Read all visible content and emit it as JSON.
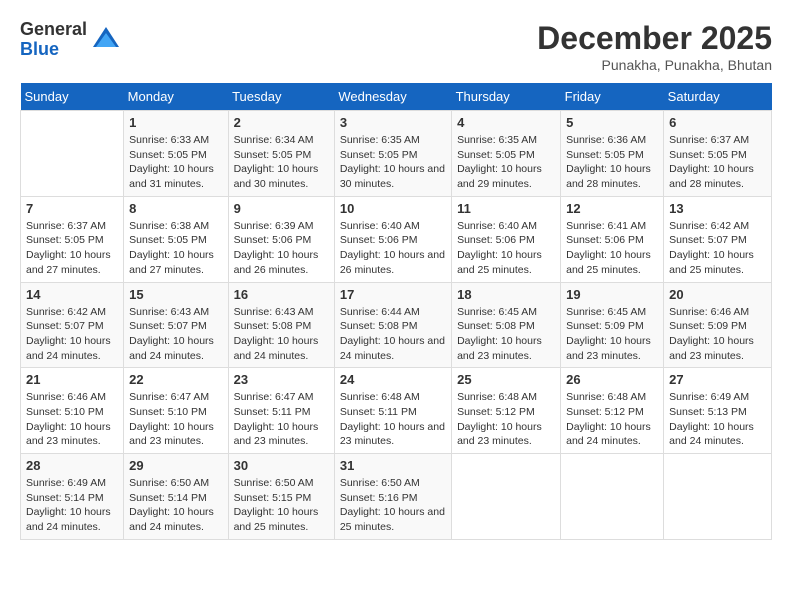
{
  "logo": {
    "general": "General",
    "blue": "Blue"
  },
  "title": "December 2025",
  "subtitle": "Punakha, Punakha, Bhutan",
  "weekdays": [
    "Sunday",
    "Monday",
    "Tuesday",
    "Wednesday",
    "Thursday",
    "Friday",
    "Saturday"
  ],
  "weeks": [
    [
      {
        "day": "",
        "sunrise": "",
        "sunset": "",
        "daylight": ""
      },
      {
        "day": "1",
        "sunrise": "Sunrise: 6:33 AM",
        "sunset": "Sunset: 5:05 PM",
        "daylight": "Daylight: 10 hours and 31 minutes."
      },
      {
        "day": "2",
        "sunrise": "Sunrise: 6:34 AM",
        "sunset": "Sunset: 5:05 PM",
        "daylight": "Daylight: 10 hours and 30 minutes."
      },
      {
        "day": "3",
        "sunrise": "Sunrise: 6:35 AM",
        "sunset": "Sunset: 5:05 PM",
        "daylight": "Daylight: 10 hours and 30 minutes."
      },
      {
        "day": "4",
        "sunrise": "Sunrise: 6:35 AM",
        "sunset": "Sunset: 5:05 PM",
        "daylight": "Daylight: 10 hours and 29 minutes."
      },
      {
        "day": "5",
        "sunrise": "Sunrise: 6:36 AM",
        "sunset": "Sunset: 5:05 PM",
        "daylight": "Daylight: 10 hours and 28 minutes."
      },
      {
        "day": "6",
        "sunrise": "Sunrise: 6:37 AM",
        "sunset": "Sunset: 5:05 PM",
        "daylight": "Daylight: 10 hours and 28 minutes."
      }
    ],
    [
      {
        "day": "7",
        "sunrise": "Sunrise: 6:37 AM",
        "sunset": "Sunset: 5:05 PM",
        "daylight": "Daylight: 10 hours and 27 minutes."
      },
      {
        "day": "8",
        "sunrise": "Sunrise: 6:38 AM",
        "sunset": "Sunset: 5:05 PM",
        "daylight": "Daylight: 10 hours and 27 minutes."
      },
      {
        "day": "9",
        "sunrise": "Sunrise: 6:39 AM",
        "sunset": "Sunset: 5:06 PM",
        "daylight": "Daylight: 10 hours and 26 minutes."
      },
      {
        "day": "10",
        "sunrise": "Sunrise: 6:40 AM",
        "sunset": "Sunset: 5:06 PM",
        "daylight": "Daylight: 10 hours and 26 minutes."
      },
      {
        "day": "11",
        "sunrise": "Sunrise: 6:40 AM",
        "sunset": "Sunset: 5:06 PM",
        "daylight": "Daylight: 10 hours and 25 minutes."
      },
      {
        "day": "12",
        "sunrise": "Sunrise: 6:41 AM",
        "sunset": "Sunset: 5:06 PM",
        "daylight": "Daylight: 10 hours and 25 minutes."
      },
      {
        "day": "13",
        "sunrise": "Sunrise: 6:42 AM",
        "sunset": "Sunset: 5:07 PM",
        "daylight": "Daylight: 10 hours and 25 minutes."
      }
    ],
    [
      {
        "day": "14",
        "sunrise": "Sunrise: 6:42 AM",
        "sunset": "Sunset: 5:07 PM",
        "daylight": "Daylight: 10 hours and 24 minutes."
      },
      {
        "day": "15",
        "sunrise": "Sunrise: 6:43 AM",
        "sunset": "Sunset: 5:07 PM",
        "daylight": "Daylight: 10 hours and 24 minutes."
      },
      {
        "day": "16",
        "sunrise": "Sunrise: 6:43 AM",
        "sunset": "Sunset: 5:08 PM",
        "daylight": "Daylight: 10 hours and 24 minutes."
      },
      {
        "day": "17",
        "sunrise": "Sunrise: 6:44 AM",
        "sunset": "Sunset: 5:08 PM",
        "daylight": "Daylight: 10 hours and 24 minutes."
      },
      {
        "day": "18",
        "sunrise": "Sunrise: 6:45 AM",
        "sunset": "Sunset: 5:08 PM",
        "daylight": "Daylight: 10 hours and 23 minutes."
      },
      {
        "day": "19",
        "sunrise": "Sunrise: 6:45 AM",
        "sunset": "Sunset: 5:09 PM",
        "daylight": "Daylight: 10 hours and 23 minutes."
      },
      {
        "day": "20",
        "sunrise": "Sunrise: 6:46 AM",
        "sunset": "Sunset: 5:09 PM",
        "daylight": "Daylight: 10 hours and 23 minutes."
      }
    ],
    [
      {
        "day": "21",
        "sunrise": "Sunrise: 6:46 AM",
        "sunset": "Sunset: 5:10 PM",
        "daylight": "Daylight: 10 hours and 23 minutes."
      },
      {
        "day": "22",
        "sunrise": "Sunrise: 6:47 AM",
        "sunset": "Sunset: 5:10 PM",
        "daylight": "Daylight: 10 hours and 23 minutes."
      },
      {
        "day": "23",
        "sunrise": "Sunrise: 6:47 AM",
        "sunset": "Sunset: 5:11 PM",
        "daylight": "Daylight: 10 hours and 23 minutes."
      },
      {
        "day": "24",
        "sunrise": "Sunrise: 6:48 AM",
        "sunset": "Sunset: 5:11 PM",
        "daylight": "Daylight: 10 hours and 23 minutes."
      },
      {
        "day": "25",
        "sunrise": "Sunrise: 6:48 AM",
        "sunset": "Sunset: 5:12 PM",
        "daylight": "Daylight: 10 hours and 23 minutes."
      },
      {
        "day": "26",
        "sunrise": "Sunrise: 6:48 AM",
        "sunset": "Sunset: 5:12 PM",
        "daylight": "Daylight: 10 hours and 24 minutes."
      },
      {
        "day": "27",
        "sunrise": "Sunrise: 6:49 AM",
        "sunset": "Sunset: 5:13 PM",
        "daylight": "Daylight: 10 hours and 24 minutes."
      }
    ],
    [
      {
        "day": "28",
        "sunrise": "Sunrise: 6:49 AM",
        "sunset": "Sunset: 5:14 PM",
        "daylight": "Daylight: 10 hours and 24 minutes."
      },
      {
        "day": "29",
        "sunrise": "Sunrise: 6:50 AM",
        "sunset": "Sunset: 5:14 PM",
        "daylight": "Daylight: 10 hours and 24 minutes."
      },
      {
        "day": "30",
        "sunrise": "Sunrise: 6:50 AM",
        "sunset": "Sunset: 5:15 PM",
        "daylight": "Daylight: 10 hours and 25 minutes."
      },
      {
        "day": "31",
        "sunrise": "Sunrise: 6:50 AM",
        "sunset": "Sunset: 5:16 PM",
        "daylight": "Daylight: 10 hours and 25 minutes."
      },
      {
        "day": "",
        "sunrise": "",
        "sunset": "",
        "daylight": ""
      },
      {
        "day": "",
        "sunrise": "",
        "sunset": "",
        "daylight": ""
      },
      {
        "day": "",
        "sunrise": "",
        "sunset": "",
        "daylight": ""
      }
    ]
  ]
}
